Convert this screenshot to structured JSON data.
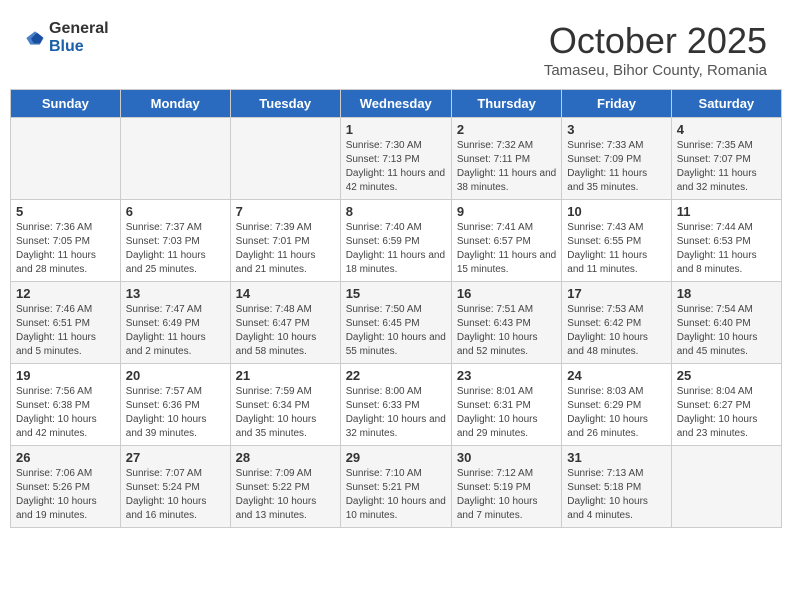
{
  "header": {
    "logo_general": "General",
    "logo_blue": "Blue",
    "month": "October 2025",
    "location": "Tamaseu, Bihor County, Romania"
  },
  "days_of_week": [
    "Sunday",
    "Monday",
    "Tuesday",
    "Wednesday",
    "Thursday",
    "Friday",
    "Saturday"
  ],
  "weeks": [
    [
      {
        "day": "",
        "info": ""
      },
      {
        "day": "",
        "info": ""
      },
      {
        "day": "",
        "info": ""
      },
      {
        "day": "1",
        "info": "Sunrise: 7:30 AM\nSunset: 7:13 PM\nDaylight: 11 hours and 42 minutes."
      },
      {
        "day": "2",
        "info": "Sunrise: 7:32 AM\nSunset: 7:11 PM\nDaylight: 11 hours and 38 minutes."
      },
      {
        "day": "3",
        "info": "Sunrise: 7:33 AM\nSunset: 7:09 PM\nDaylight: 11 hours and 35 minutes."
      },
      {
        "day": "4",
        "info": "Sunrise: 7:35 AM\nSunset: 7:07 PM\nDaylight: 11 hours and 32 minutes."
      }
    ],
    [
      {
        "day": "5",
        "info": "Sunrise: 7:36 AM\nSunset: 7:05 PM\nDaylight: 11 hours and 28 minutes."
      },
      {
        "day": "6",
        "info": "Sunrise: 7:37 AM\nSunset: 7:03 PM\nDaylight: 11 hours and 25 minutes."
      },
      {
        "day": "7",
        "info": "Sunrise: 7:39 AM\nSunset: 7:01 PM\nDaylight: 11 hours and 21 minutes."
      },
      {
        "day": "8",
        "info": "Sunrise: 7:40 AM\nSunset: 6:59 PM\nDaylight: 11 hours and 18 minutes."
      },
      {
        "day": "9",
        "info": "Sunrise: 7:41 AM\nSunset: 6:57 PM\nDaylight: 11 hours and 15 minutes."
      },
      {
        "day": "10",
        "info": "Sunrise: 7:43 AM\nSunset: 6:55 PM\nDaylight: 11 hours and 11 minutes."
      },
      {
        "day": "11",
        "info": "Sunrise: 7:44 AM\nSunset: 6:53 PM\nDaylight: 11 hours and 8 minutes."
      }
    ],
    [
      {
        "day": "12",
        "info": "Sunrise: 7:46 AM\nSunset: 6:51 PM\nDaylight: 11 hours and 5 minutes."
      },
      {
        "day": "13",
        "info": "Sunrise: 7:47 AM\nSunset: 6:49 PM\nDaylight: 11 hours and 2 minutes."
      },
      {
        "day": "14",
        "info": "Sunrise: 7:48 AM\nSunset: 6:47 PM\nDaylight: 10 hours and 58 minutes."
      },
      {
        "day": "15",
        "info": "Sunrise: 7:50 AM\nSunset: 6:45 PM\nDaylight: 10 hours and 55 minutes."
      },
      {
        "day": "16",
        "info": "Sunrise: 7:51 AM\nSunset: 6:43 PM\nDaylight: 10 hours and 52 minutes."
      },
      {
        "day": "17",
        "info": "Sunrise: 7:53 AM\nSunset: 6:42 PM\nDaylight: 10 hours and 48 minutes."
      },
      {
        "day": "18",
        "info": "Sunrise: 7:54 AM\nSunset: 6:40 PM\nDaylight: 10 hours and 45 minutes."
      }
    ],
    [
      {
        "day": "19",
        "info": "Sunrise: 7:56 AM\nSunset: 6:38 PM\nDaylight: 10 hours and 42 minutes."
      },
      {
        "day": "20",
        "info": "Sunrise: 7:57 AM\nSunset: 6:36 PM\nDaylight: 10 hours and 39 minutes."
      },
      {
        "day": "21",
        "info": "Sunrise: 7:59 AM\nSunset: 6:34 PM\nDaylight: 10 hours and 35 minutes."
      },
      {
        "day": "22",
        "info": "Sunrise: 8:00 AM\nSunset: 6:33 PM\nDaylight: 10 hours and 32 minutes."
      },
      {
        "day": "23",
        "info": "Sunrise: 8:01 AM\nSunset: 6:31 PM\nDaylight: 10 hours and 29 minutes."
      },
      {
        "day": "24",
        "info": "Sunrise: 8:03 AM\nSunset: 6:29 PM\nDaylight: 10 hours and 26 minutes."
      },
      {
        "day": "25",
        "info": "Sunrise: 8:04 AM\nSunset: 6:27 PM\nDaylight: 10 hours and 23 minutes."
      }
    ],
    [
      {
        "day": "26",
        "info": "Sunrise: 7:06 AM\nSunset: 5:26 PM\nDaylight: 10 hours and 19 minutes."
      },
      {
        "day": "27",
        "info": "Sunrise: 7:07 AM\nSunset: 5:24 PM\nDaylight: 10 hours and 16 minutes."
      },
      {
        "day": "28",
        "info": "Sunrise: 7:09 AM\nSunset: 5:22 PM\nDaylight: 10 hours and 13 minutes."
      },
      {
        "day": "29",
        "info": "Sunrise: 7:10 AM\nSunset: 5:21 PM\nDaylight: 10 hours and 10 minutes."
      },
      {
        "day": "30",
        "info": "Sunrise: 7:12 AM\nSunset: 5:19 PM\nDaylight: 10 hours and 7 minutes."
      },
      {
        "day": "31",
        "info": "Sunrise: 7:13 AM\nSunset: 5:18 PM\nDaylight: 10 hours and 4 minutes."
      },
      {
        "day": "",
        "info": ""
      }
    ]
  ]
}
